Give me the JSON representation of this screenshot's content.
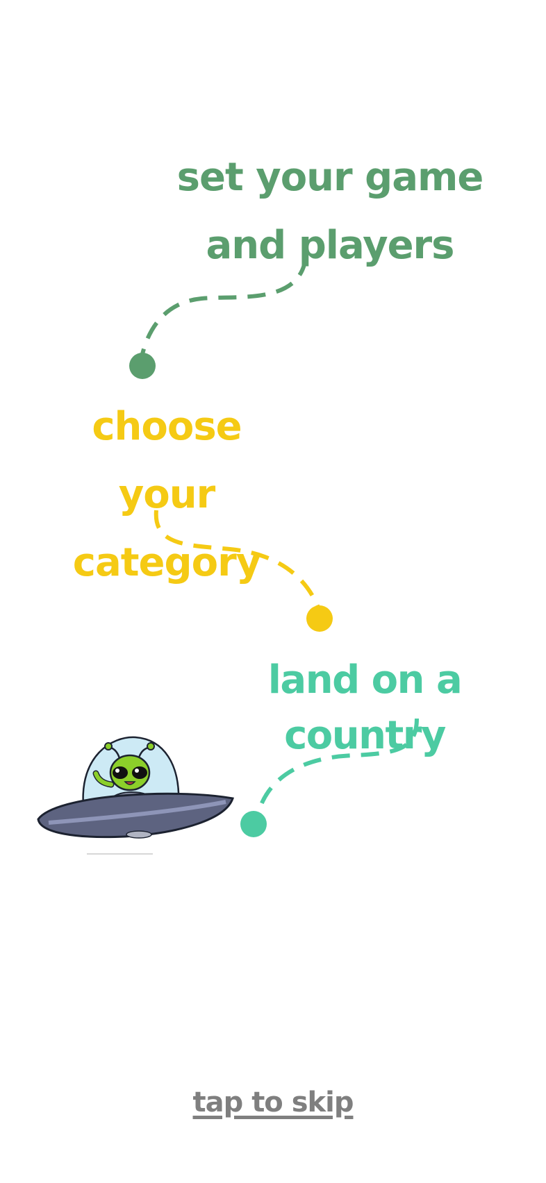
{
  "steps": [
    {
      "text": "set your game and players",
      "color": "#5b9e6e"
    },
    {
      "text": "choose your category",
      "color": "#f5ca14"
    },
    {
      "text": "land on a country",
      "color": "#4ccba2"
    }
  ],
  "skip": {
    "label": "tap to skip",
    "color": "#7f7f7f"
  },
  "illustration": {
    "icon": "alien-ufo-icon"
  }
}
